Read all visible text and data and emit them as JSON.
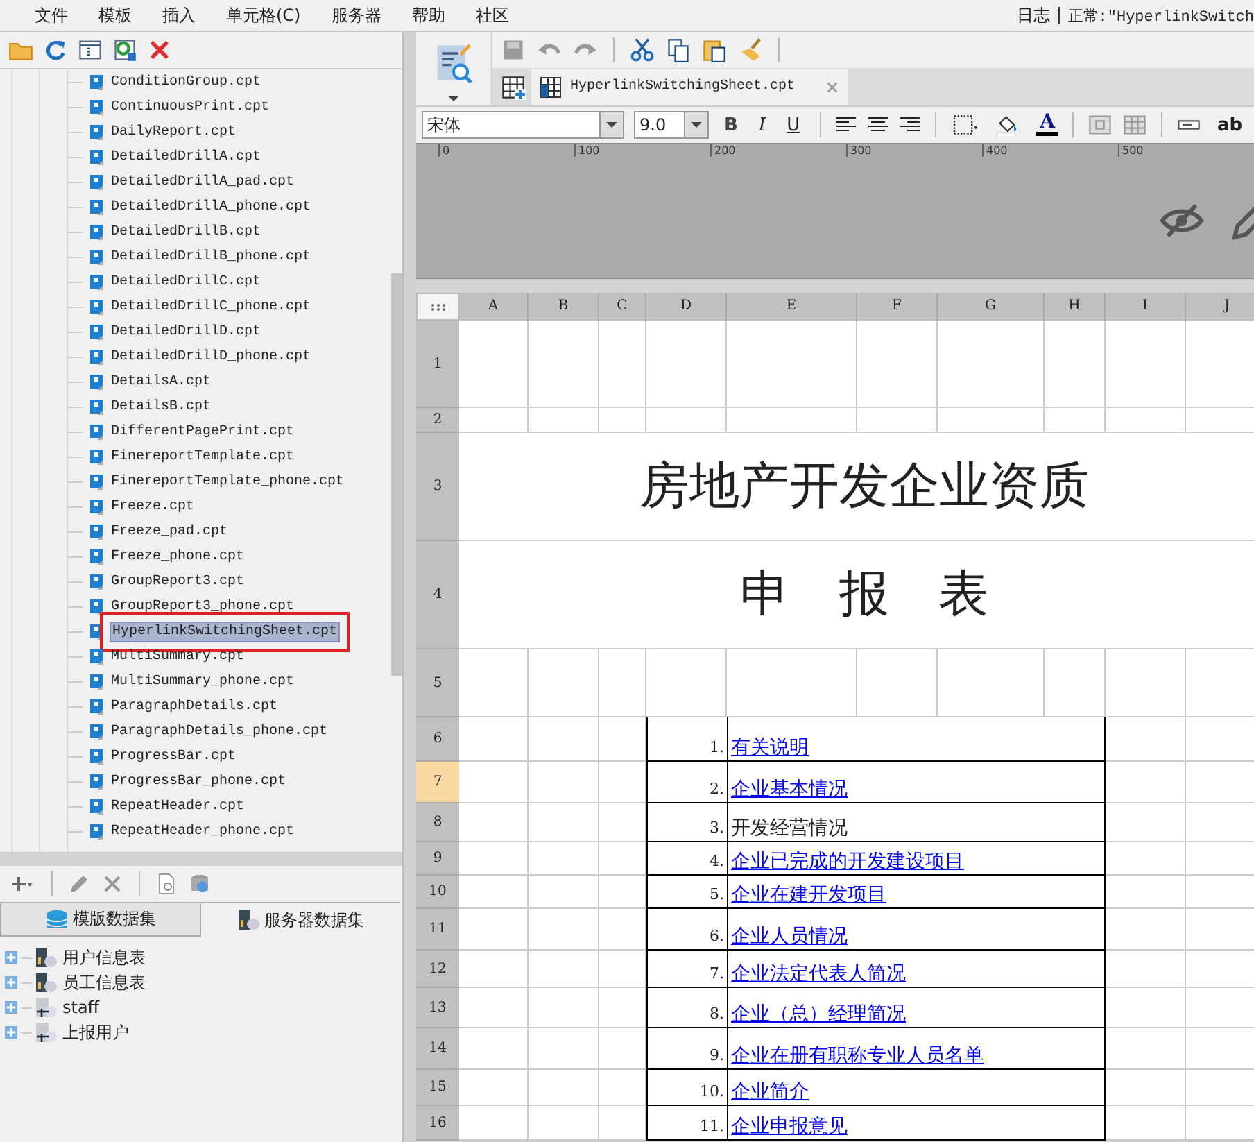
{
  "menu": [
    "文件",
    "模板",
    "插入",
    "单元格(C)",
    "服务器",
    "帮助",
    "社区"
  ],
  "status": {
    "log": "日志",
    "state": "正常:\"HyperlinkSwitch"
  },
  "files": [
    {
      "name": "ConditionGroup.cpt",
      "selected": false
    },
    {
      "name": "ContinuousPrint.cpt",
      "selected": false
    },
    {
      "name": "DailyReport.cpt",
      "selected": false
    },
    {
      "name": "DetailedDrillA.cpt",
      "selected": false
    },
    {
      "name": "DetailedDrillA_pad.cpt",
      "selected": false
    },
    {
      "name": "DetailedDrillA_phone.cpt",
      "selected": false
    },
    {
      "name": "DetailedDrillB.cpt",
      "selected": false
    },
    {
      "name": "DetailedDrillB_phone.cpt",
      "selected": false
    },
    {
      "name": "DetailedDrillC.cpt",
      "selected": false
    },
    {
      "name": "DetailedDrillC_phone.cpt",
      "selected": false
    },
    {
      "name": "DetailedDrillD.cpt",
      "selected": false
    },
    {
      "name": "DetailedDrillD_phone.cpt",
      "selected": false
    },
    {
      "name": "DetailsA.cpt",
      "selected": false
    },
    {
      "name": "DetailsB.cpt",
      "selected": false
    },
    {
      "name": "DifferentPagePrint.cpt",
      "selected": false
    },
    {
      "name": "FinereportTemplate.cpt",
      "selected": false
    },
    {
      "name": "FinereportTemplate_phone.cpt",
      "selected": false
    },
    {
      "name": "Freeze.cpt",
      "selected": false
    },
    {
      "name": "Freeze_pad.cpt",
      "selected": false
    },
    {
      "name": "Freeze_phone.cpt",
      "selected": false
    },
    {
      "name": "GroupReport3.cpt",
      "selected": false
    },
    {
      "name": "GroupReport3_phone.cpt",
      "selected": false
    },
    {
      "name": "HyperlinkSwitchingSheet.cpt",
      "selected": true
    },
    {
      "name": "MultiSummary.cpt",
      "selected": false
    },
    {
      "name": "MultiSummary_phone.cpt",
      "selected": false
    },
    {
      "name": "ParagraphDetails.cpt",
      "selected": false
    },
    {
      "name": "ParagraphDetails_phone.cpt",
      "selected": false
    },
    {
      "name": "ProgressBar.cpt",
      "selected": false
    },
    {
      "name": "ProgressBar_phone.cpt",
      "selected": false
    },
    {
      "name": "RepeatHeader.cpt",
      "selected": false
    },
    {
      "name": "RepeatHeader_phone.cpt",
      "selected": false
    }
  ],
  "dataset_tabs": [
    {
      "label": "模版数据集",
      "selected": true
    },
    {
      "label": "服务器数据集",
      "selected": false
    }
  ],
  "datasets": [
    {
      "name": "用户信息表",
      "kind": "dataset"
    },
    {
      "name": "员工信息表",
      "kind": "dataset"
    },
    {
      "name": "staff",
      "kind": "table"
    },
    {
      "name": "上报用户",
      "kind": "table"
    }
  ],
  "doc_tab": {
    "title": "HyperlinkSwitchingSheet.cpt"
  },
  "format": {
    "font": "宋体",
    "size": "9.0",
    "styles": [
      "B",
      "I",
      "U"
    ],
    "font_color": "A",
    "insert": "ab"
  },
  "ruler": [
    "0",
    "100",
    "200",
    "300",
    "400",
    "500"
  ],
  "sheet": {
    "columns": [
      "A",
      "B",
      "C",
      "D",
      "E",
      "F",
      "G",
      "H",
      "I",
      "J"
    ],
    "rows": [
      {
        "label": "1",
        "selected": false
      },
      {
        "label": "2",
        "selected": false
      },
      {
        "label": "3",
        "selected": false
      },
      {
        "label": "4",
        "selected": false
      },
      {
        "label": "5",
        "selected": false
      },
      {
        "label": "6",
        "selected": false
      },
      {
        "label": "7",
        "selected": true
      },
      {
        "label": "8",
        "selected": false
      },
      {
        "label": "9",
        "selected": false
      },
      {
        "label": "10",
        "selected": false
      },
      {
        "label": "11",
        "selected": false
      },
      {
        "label": "12",
        "selected": false
      },
      {
        "label": "13",
        "selected": false
      },
      {
        "label": "14",
        "selected": false
      },
      {
        "label": "15",
        "selected": false
      },
      {
        "label": "16",
        "selected": false
      }
    ],
    "title": "房地产开发企业资质",
    "subtitle": "申 报 表",
    "items": [
      {
        "num": "1.",
        "text": "有关说明",
        "link": true
      },
      {
        "num": "2.",
        "text": "企业基本情况",
        "link": true
      },
      {
        "num": "3.",
        "text": "开发经营情况",
        "link": false
      },
      {
        "num": "4.",
        "text": "企业已完成的开发建设项目",
        "link": true
      },
      {
        "num": "5.",
        "text": "企业在建开发项目",
        "link": true
      },
      {
        "num": "6.",
        "text": "企业人员情况",
        "link": true
      },
      {
        "num": "7.",
        "text": "企业法定代表人简况",
        "link": true
      },
      {
        "num": "8.",
        "text": "企业（总）经理简况",
        "link": true
      },
      {
        "num": "9.",
        "text": "企业在册有职称专业人员名单",
        "link": true
      },
      {
        "num": "10.",
        "text": "企业简介",
        "link": true
      },
      {
        "num": "11.",
        "text": "企业申报意见",
        "link": true
      }
    ]
  }
}
